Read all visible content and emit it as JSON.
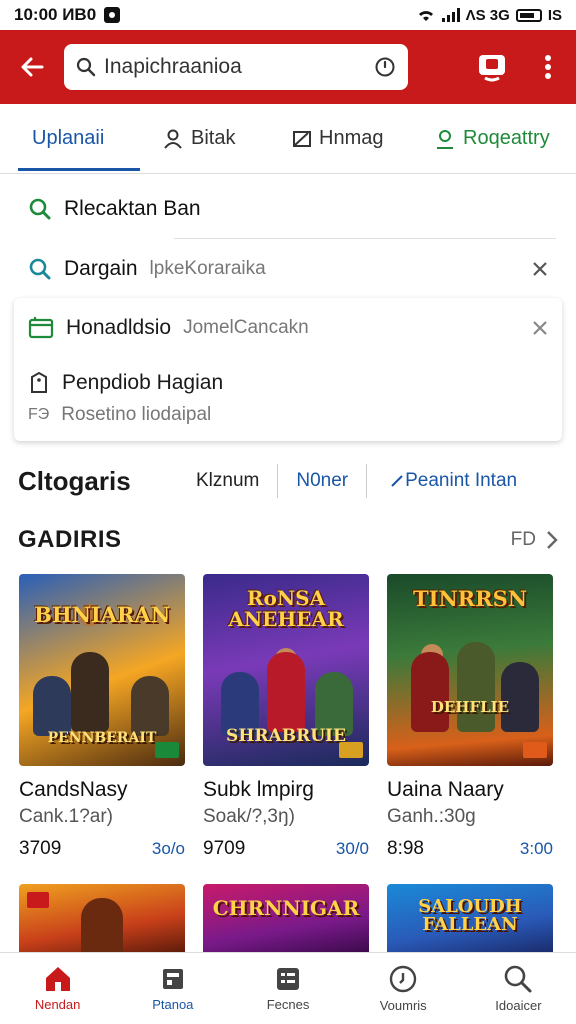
{
  "status_bar": {
    "time": "10:00 ИB0",
    "right_text": "ΛS 3G",
    "battery_text": "IS"
  },
  "search": {
    "query": "Inapichraanioa"
  },
  "tabs": [
    {
      "label": "Uplanaii"
    },
    {
      "label": "Bitak"
    },
    {
      "label": "Hnmag"
    },
    {
      "label": "Roqeattry"
    }
  ],
  "suggestions": [
    {
      "main": "Rlecaktan Ban",
      "sub": ""
    },
    {
      "main": "Dargain",
      "sub": "lpkeKoraraika"
    }
  ],
  "recent_card": {
    "row1": {
      "main": "Honadldsio",
      "sub": "JomelCancakn"
    },
    "row2": {
      "main": "Penpdiob Hagian"
    },
    "row3": {
      "prefix": "FЭ",
      "main": "Rosetino liodaipal"
    }
  },
  "categories": {
    "title": "Cltogaris",
    "chips": [
      "Klznum",
      "N0ner",
      "Peanint Intan"
    ]
  },
  "section": {
    "title": "GADIRIS",
    "more_label": "FD"
  },
  "games": [
    {
      "name": "CandsNasy",
      "sub": "Cank.1?ar)",
      "price": "3709",
      "rating": "3o/o",
      "art_title": "BHNIARAN",
      "art_sub": "PENNBERAIT"
    },
    {
      "name": "Subk lmpirg",
      "sub": "Soak/?,3ŋ)",
      "price": "9709",
      "rating": "30/0",
      "art_title": "RoNSA ANEHEAR",
      "art_sub": "SHRABRUIE"
    },
    {
      "name": "Uaina Naary",
      "sub": "Ganh.:30g",
      "price": "8:98",
      "rating": "3:00",
      "art_title": "TINRRSN",
      "art_sub": "DEHFLIE"
    }
  ],
  "games_row2": [
    {
      "art_title": ""
    },
    {
      "art_title": "CHRNNIGAR"
    },
    {
      "art_title": "SALOUDH FALLEAN"
    }
  ],
  "bottom_nav": [
    {
      "label": "Nendan"
    },
    {
      "label": "Ptanoa"
    },
    {
      "label": "Fecnes"
    },
    {
      "label": "Voumris"
    },
    {
      "label": "Idoaicer"
    }
  ],
  "colors": {
    "brand_red": "#c81a1a",
    "link_blue": "#1a56a8",
    "green": "#1f8a3a"
  }
}
